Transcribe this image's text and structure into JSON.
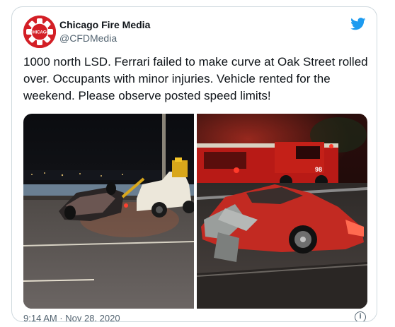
{
  "tweet": {
    "display_name": "Chicago Fire Media",
    "handle": "@CFDMedia",
    "text": "1000 north LSD.  Ferrari failed to make curve at Oak Street rolled over. Occupants with minor injuries. Vehicle rented for the weekend. Please observe posted speed limits!",
    "timestamp": "9:14 AM · Nov 28, 2020",
    "info_glyph": "i"
  },
  "avatar": {
    "logo_text": "CHICAGO",
    "color": "#d31f26"
  },
  "icons": {
    "platform": "twitter-bird-icon",
    "info": "info-icon"
  },
  "photos": [
    {
      "subject": "overturned-car-and-tow-truck-night"
    },
    {
      "subject": "wrecked-red-ferrari-fire-truck",
      "truck_number": "98"
    }
  ],
  "colors": {
    "accent": "#1d9bf0",
    "text": "#0f1419",
    "secondary": "#536471",
    "border": "#cfd9de",
    "avatar_red": "#d31f26"
  }
}
